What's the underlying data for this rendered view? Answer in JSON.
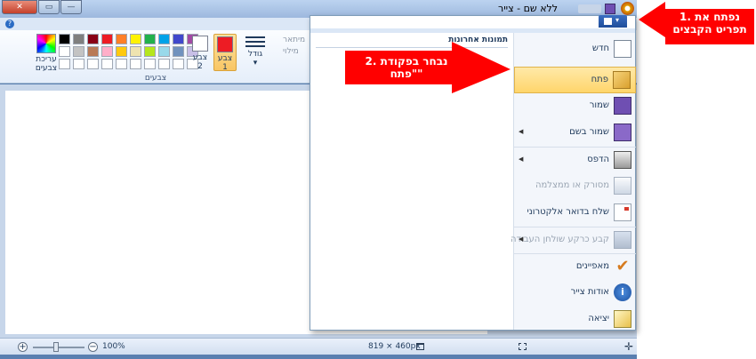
{
  "window": {
    "title": "ללא שם - צייר",
    "close_glyph": "✕",
    "max_glyph": "▭",
    "min_glyph": "—",
    "help_glyph": "?"
  },
  "ribbon": {
    "edit_colors_label": "עריכת צבעים",
    "color2_label": "צבע 2",
    "color1_label": "צבע 1",
    "size_label": "גודל",
    "outline_label": "מיתאר",
    "fill_label": "מילוי",
    "group_label": "צבעים",
    "palette": [
      "#000000",
      "#7f7f7f",
      "#880015",
      "#ed1c24",
      "#ff7f27",
      "#fff200",
      "#22b14c",
      "#00a2e8",
      "#3f48cc",
      "#a349a4",
      "#ffffff",
      "#c3c3c3",
      "#b97a57",
      "#ffaec9",
      "#ffc90e",
      "#efe4b0",
      "#b5e61d",
      "#99d9ea",
      "#7092be",
      "#c8bfe7",
      "#ffffff",
      "#ffffff",
      "#ffffff",
      "#ffffff",
      "#ffffff",
      "#ffffff",
      "#ffffff",
      "#ffffff",
      "#ffffff",
      "#ffffff"
    ],
    "color1_value": "#ed1c24",
    "color2_value": "#ffffff"
  },
  "status": {
    "zoom": "100%",
    "dimensions": "819 × 460px"
  },
  "file_menu": {
    "recent_title": "תמונות אחרונות",
    "items": [
      {
        "label": "חדש",
        "icon": "new-icon",
        "arrow": false,
        "disabled": false
      },
      {
        "label": "פתח",
        "icon": "open-icon",
        "arrow": false,
        "disabled": false,
        "highlight": true
      },
      {
        "label": "שמור",
        "icon": "save-icon",
        "arrow": false,
        "disabled": false
      },
      {
        "label": "שמור בשם",
        "icon": "save-as-icon",
        "arrow": true,
        "disabled": false
      },
      {
        "label": "הדפס",
        "icon": "print-icon",
        "arrow": true,
        "disabled": false
      },
      {
        "label": "מסורק או ממצלמה",
        "icon": "scanner-icon",
        "arrow": false,
        "disabled": true
      },
      {
        "label": "שלח בדואר אלקטרוני",
        "icon": "email-icon",
        "arrow": false,
        "disabled": false
      },
      {
        "label": "קבע כרקע שולחן העבודה",
        "icon": "desktop-background-icon",
        "arrow": true,
        "disabled": true
      },
      {
        "label": "מאפיינים",
        "icon": "properties-icon",
        "arrow": false,
        "disabled": false
      },
      {
        "label": "אודות צייר",
        "icon": "about-icon",
        "arrow": false,
        "disabled": false
      },
      {
        "label": "יציאה",
        "icon": "exit-icon",
        "arrow": false,
        "disabled": false
      }
    ]
  },
  "callouts": {
    "step1": "1. נפתח את תפריט הקבצים",
    "step2": "2. נבחר בפקודת \"פתח\"",
    "color": "#ff0000"
  }
}
